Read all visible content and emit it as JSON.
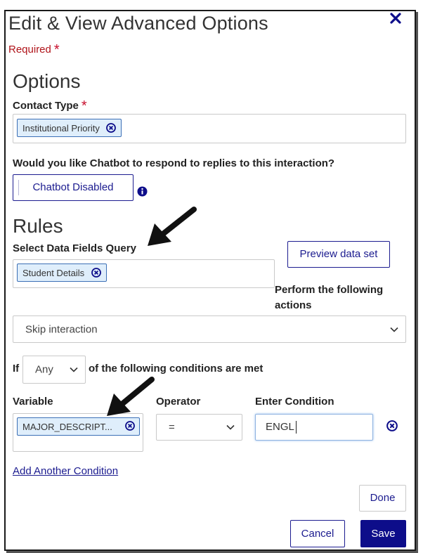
{
  "dialog": {
    "title": "Edit & View Advanced Options",
    "required_label": "Required",
    "required_star": "*"
  },
  "options": {
    "heading": "Options",
    "contact_type_label": "Contact Type",
    "contact_type_star": "*",
    "contact_type_chip": "Institutional Priority",
    "chatbot_question": "Would you like Chatbot to respond to replies to this interaction?",
    "chatbot_button": "Chatbot Disabled"
  },
  "rules": {
    "heading": "Rules",
    "query_label": "Select Data Fields Query",
    "query_chip": "Student Details",
    "preview_button": "Preview data set",
    "perform_label": "Perform the following actions",
    "action_select": "Skip interaction",
    "if_label": "If",
    "match_select": "Any",
    "conditions_text": "of the following conditions are met",
    "variable_label": "Variable",
    "variable_chip": "MAJOR_DESCRIPT...",
    "operator_label": "Operator",
    "operator_select": "=",
    "condition_label": "Enter Condition",
    "condition_value": "ENGL",
    "add_condition_link": "Add Another Condition",
    "done_button": "Done"
  },
  "footer": {
    "cancel_button": "Cancel",
    "save_button": "Save"
  },
  "colors": {
    "accent": "#0d0d8a",
    "required": "#b0141a",
    "chip_bg": "#dfeefb",
    "chip_border": "#3b6fb6"
  }
}
